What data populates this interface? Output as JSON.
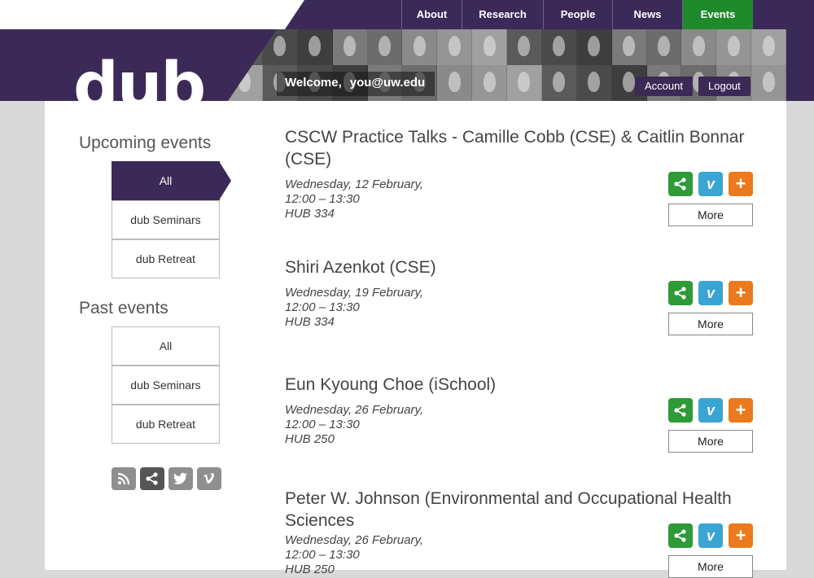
{
  "nav": {
    "items": [
      {
        "label": "About"
      },
      {
        "label": "Research"
      },
      {
        "label": "People"
      },
      {
        "label": "News"
      },
      {
        "label": "Events"
      }
    ]
  },
  "header": {
    "logo": "dub",
    "welcome": "Welcome,",
    "email": "you@uw.edu",
    "account": "Account",
    "logout": "Logout"
  },
  "sidebar": {
    "upcoming_heading": "Upcoming events",
    "upcoming": [
      {
        "label": "All"
      },
      {
        "label": "dub Seminars"
      },
      {
        "label": "dub Retreat"
      }
    ],
    "past_heading": "Past events",
    "past": [
      {
        "label": "All"
      },
      {
        "label": "dub Seminars"
      },
      {
        "label": "dub Retreat"
      }
    ]
  },
  "events": [
    {
      "title": "CSCW Practice Talks - Camille Cobb (CSE) & Caitlin Bonnar (CSE)",
      "date": "Wednesday, 12 February,",
      "time": "12:00 – 13:30",
      "room": "HUB 334",
      "more": "More"
    },
    {
      "title": "Shiri Azenkot (CSE)",
      "date": "Wednesday, 19 February,",
      "time": "12:00 – 13:30",
      "room": "HUB 334",
      "more": "More"
    },
    {
      "title": "Eun Kyoung Choe (iSchool)",
      "date": "Wednesday, 26 February,",
      "time": "12:00 – 13:30",
      "room": "HUB 250",
      "more": "More"
    },
    {
      "title": "Peter W. Johnson (Environmental and Occupational Health Sciences",
      "date": "Wednesday, 26 February,",
      "time": "12:00 – 13:30",
      "room": "HUB 250",
      "more": "More"
    }
  ],
  "icons": {
    "share": "share-icon",
    "vimeo": "vimeo-icon",
    "add": "add-icon",
    "rss": "rss-icon",
    "twitter": "twitter-icon"
  },
  "colors": {
    "brand_purple": "#3b2a57",
    "active_green": "#1e8a2c",
    "share_green": "#2e9a38",
    "vimeo_blue": "#3aa4d4",
    "add_orange": "#ea7a1d"
  }
}
